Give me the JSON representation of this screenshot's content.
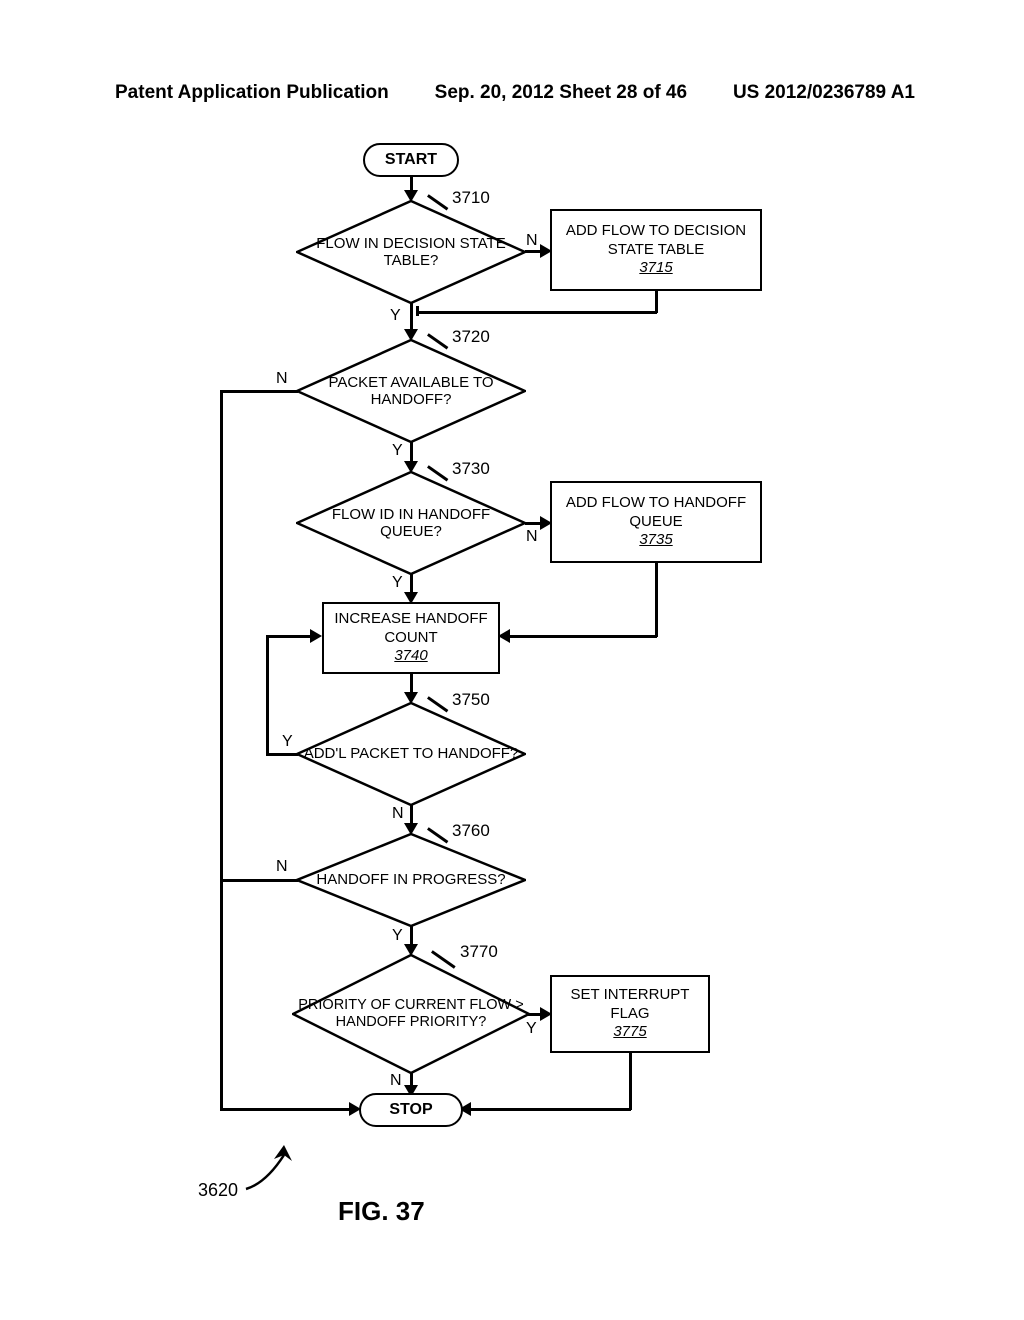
{
  "header": {
    "left": "Patent Application Publication",
    "mid": "Sep. 20, 2012  Sheet 28 of 46",
    "right": "US 2012/0236789 A1"
  },
  "terminators": {
    "start": "START",
    "stop": "STOP"
  },
  "decisions": {
    "d3710": "FLOW IN DECISION STATE TABLE?",
    "d3720": "PACKET AVAILABLE TO HANDOFF?",
    "d3730": "FLOW ID IN HANDOFF QUEUE?",
    "d3750": "ADD'L PACKET TO HANDOFF?",
    "d3760": "HANDOFF IN PROGRESS?",
    "d3770": "PRIORITY OF CURRENT FLOW > HANDOFF PRIORITY?"
  },
  "processes": {
    "p3715": {
      "text": "ADD FLOW TO DECISION STATE TABLE",
      "ref": "3715"
    },
    "p3735": {
      "text": "ADD FLOW TO HANDOFF QUEUE",
      "ref": "3735"
    },
    "p3740": {
      "text": "INCREASE HANDOFF COUNT",
      "ref": "3740"
    },
    "p3775": {
      "text": "SET INTERRUPT FLAG",
      "ref": "3775"
    }
  },
  "refs": {
    "r3710": "3710",
    "r3720": "3720",
    "r3730": "3730",
    "r3750": "3750",
    "r3760": "3760",
    "r3770": "3770",
    "r3620": "3620"
  },
  "labels": {
    "Y": "Y",
    "N": "N"
  },
  "figure": "FIG. 37"
}
